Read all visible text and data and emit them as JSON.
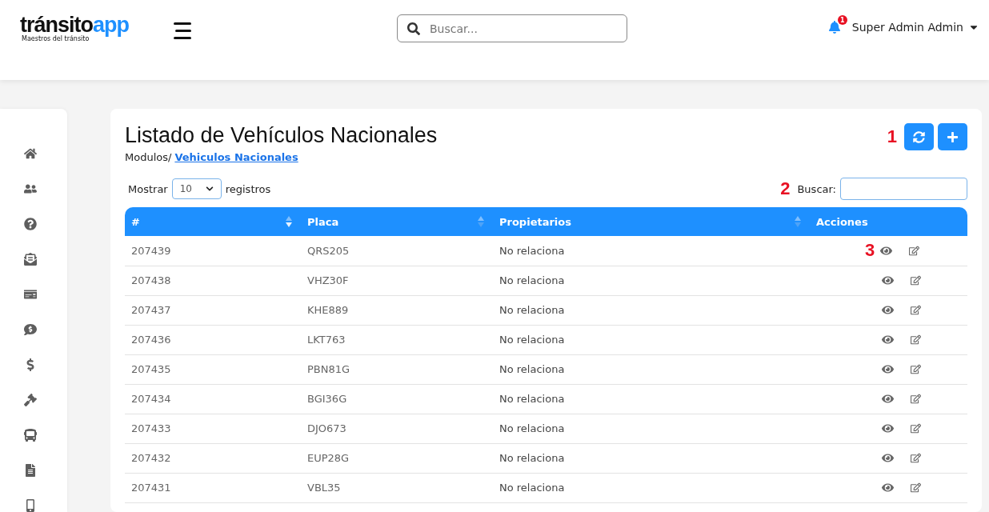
{
  "header": {
    "logo": {
      "main": "tránsito",
      "accent": "app",
      "tagline": "Maestros del tránsito"
    },
    "search": {
      "placeholder": "Buscar..."
    },
    "notifications": {
      "count": "1"
    },
    "user": {
      "name": "Super Admin Admin"
    }
  },
  "sidebar": {
    "items": [
      {
        "kind": "home"
      },
      {
        "kind": "users"
      },
      {
        "kind": "help"
      },
      {
        "kind": "mail"
      },
      {
        "kind": "card"
      },
      {
        "kind": "chat"
      },
      {
        "kind": "dollar"
      },
      {
        "kind": "gavel"
      },
      {
        "kind": "bus"
      },
      {
        "kind": "file"
      },
      {
        "kind": "phone"
      }
    ]
  },
  "page": {
    "title": "Listado de Vehículos Nacionales",
    "breadcrumb": {
      "prefix": "Modulos/",
      "link": "Vehiculos Nacionales"
    },
    "actions": [
      {
        "kind": "refresh"
      },
      {
        "kind": "add"
      }
    ],
    "markers": [
      "1",
      "2",
      "3"
    ],
    "length": {
      "label_before": "Mostrar",
      "value": "10",
      "label_after": "registros"
    },
    "filter": {
      "label": "Buscar:"
    },
    "table": {
      "columns": [
        {
          "label": "#",
          "sortable": true,
          "sorted": true
        },
        {
          "label": "Placa",
          "sortable": true,
          "sorted": false
        },
        {
          "label": "Propietarios",
          "sortable": true,
          "sorted": false
        },
        {
          "label": "Acciones",
          "sortable": false
        }
      ],
      "rows": [
        {
          "id": "207439",
          "plate": "QRS205",
          "owners": "No relaciona"
        },
        {
          "id": "207438",
          "plate": "VHZ30F",
          "owners": "No relaciona"
        },
        {
          "id": "207437",
          "plate": "KHE889",
          "owners": "No relaciona"
        },
        {
          "id": "207436",
          "plate": "LKT763",
          "owners": "No relaciona"
        },
        {
          "id": "207435",
          "plate": "PBN81G",
          "owners": "No relaciona"
        },
        {
          "id": "207434",
          "plate": "BGI36G",
          "owners": "No relaciona"
        },
        {
          "id": "207433",
          "plate": "DJO673",
          "owners": "No relaciona"
        },
        {
          "id": "207432",
          "plate": "EUP28G",
          "owners": "No relaciona"
        },
        {
          "id": "207431",
          "plate": "VBL35",
          "owners": "No relaciona"
        }
      ]
    }
  }
}
